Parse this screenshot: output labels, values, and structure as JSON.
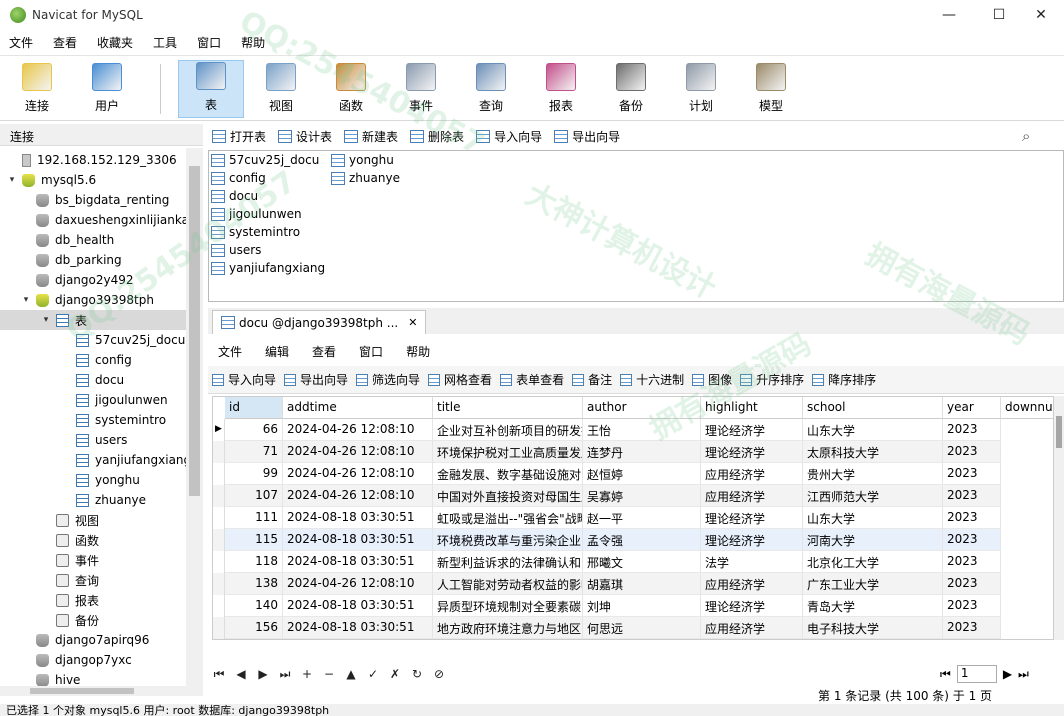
{
  "window": {
    "title": "Navicat for MySQL",
    "minimize": "—",
    "maximize": "☐",
    "close": "✕"
  },
  "menu": [
    "文件",
    "查看",
    "收藏夹",
    "工具",
    "窗口",
    "帮助"
  ],
  "toolbar": [
    {
      "label": "连接",
      "icon": "plug-icon"
    },
    {
      "label": "用户",
      "icon": "user-icon"
    },
    {
      "label": "表",
      "icon": "table-icon",
      "active": true
    },
    {
      "label": "视图",
      "icon": "view-icon"
    },
    {
      "label": "函数",
      "icon": "function-icon"
    },
    {
      "label": "事件",
      "icon": "event-icon"
    },
    {
      "label": "查询",
      "icon": "query-icon"
    },
    {
      "label": "报表",
      "icon": "report-icon"
    },
    {
      "label": "备份",
      "icon": "backup-icon"
    },
    {
      "label": "计划",
      "icon": "schedule-icon"
    },
    {
      "label": "模型",
      "icon": "model-icon"
    }
  ],
  "left_header": "连接",
  "tree": [
    {
      "label": "192.168.152.129_3306",
      "level": 0,
      "icon": "server",
      "twisty": ""
    },
    {
      "label": "mysql5.6",
      "level": 0,
      "icon": "dbopen",
      "twisty": "▾"
    },
    {
      "label": "bs_bigdata_renting",
      "level": 1,
      "icon": "db",
      "twisty": ""
    },
    {
      "label": "daxueshengxinlijiankang",
      "level": 1,
      "icon": "db",
      "twisty": ""
    },
    {
      "label": "db_health",
      "level": 1,
      "icon": "db",
      "twisty": ""
    },
    {
      "label": "db_parking",
      "level": 1,
      "icon": "db",
      "twisty": ""
    },
    {
      "label": "django2y492",
      "level": 1,
      "icon": "db",
      "twisty": ""
    },
    {
      "label": "django39398tph",
      "level": 1,
      "icon": "dbopen",
      "twisty": "▾"
    },
    {
      "label": "表",
      "level": 2,
      "icon": "tbl",
      "twisty": "▾",
      "selected": true
    },
    {
      "label": "57cuv25j_docu",
      "level": 3,
      "icon": "tbl",
      "twisty": ""
    },
    {
      "label": "config",
      "level": 3,
      "icon": "tbl",
      "twisty": ""
    },
    {
      "label": "docu",
      "level": 3,
      "icon": "tbl",
      "twisty": ""
    },
    {
      "label": "jigoulunwen",
      "level": 3,
      "icon": "tbl",
      "twisty": ""
    },
    {
      "label": "systemintro",
      "level": 3,
      "icon": "tbl",
      "twisty": ""
    },
    {
      "label": "users",
      "level": 3,
      "icon": "tbl",
      "twisty": ""
    },
    {
      "label": "yanjiufangxiang",
      "level": 3,
      "icon": "tbl",
      "twisty": ""
    },
    {
      "label": "yonghu",
      "level": 3,
      "icon": "tbl",
      "twisty": ""
    },
    {
      "label": "zhuanye",
      "level": 3,
      "icon": "tbl",
      "twisty": ""
    },
    {
      "label": "视图",
      "level": 2,
      "icon": "misc",
      "twisty": ""
    },
    {
      "label": "函数",
      "level": 2,
      "icon": "misc",
      "twisty": ""
    },
    {
      "label": "事件",
      "level": 2,
      "icon": "misc",
      "twisty": ""
    },
    {
      "label": "查询",
      "level": 2,
      "icon": "misc",
      "twisty": ""
    },
    {
      "label": "报表",
      "level": 2,
      "icon": "misc",
      "twisty": ""
    },
    {
      "label": "备份",
      "level": 2,
      "icon": "misc",
      "twisty": ""
    },
    {
      "label": "django7apirq96",
      "level": 1,
      "icon": "db",
      "twisty": ""
    },
    {
      "label": "djangop7yxc",
      "level": 1,
      "icon": "db",
      "twisty": ""
    },
    {
      "label": "hive",
      "level": 1,
      "icon": "db",
      "twisty": ""
    }
  ],
  "object_toolbar": [
    "打开表",
    "设计表",
    "新建表",
    "删除表",
    "导入向导",
    "导出向导"
  ],
  "objects": [
    "57cuv25j_docu",
    "config",
    "docu",
    "jigoulunwen",
    "systemintro",
    "users",
    "yanjiufangxiang",
    "yonghu",
    "zhuanye"
  ],
  "doc_tab": {
    "label": "docu @django39398tph ...",
    "close": "✕"
  },
  "inner_menu": [
    "文件",
    "编辑",
    "查看",
    "窗口",
    "帮助"
  ],
  "inner_toolbar": [
    "导入向导",
    "导出向导",
    "筛选向导",
    "网格查看",
    "表单查看",
    "备注",
    "十六进制",
    "图像",
    "升序排序",
    "降序排序"
  ],
  "grid": {
    "columns": [
      "id",
      "addtime",
      "title",
      "author",
      "highlight",
      "school",
      "year",
      "downnum"
    ],
    "rows": [
      [
        "66",
        "2024-04-26 12:08:10",
        "企业对互补创新项目的研发投入",
        "王怡",
        "理论经济学",
        "山东大学",
        "2023"
      ],
      [
        "71",
        "2024-04-26 12:08:10",
        "环境保护税对工业高质量发展",
        "连梦丹",
        "理论经济学",
        "太原科技大学",
        "2023"
      ],
      [
        "99",
        "2024-04-26 12:08:10",
        "金融发展、数字基础设施对",
        "赵恒婷",
        "应用经济学",
        "贵州大学",
        "2023"
      ],
      [
        "107",
        "2024-04-26 12:08:10",
        "中国对外直接投资对母国生产",
        "吴寡婷",
        "应用经济学",
        "江西师范大学",
        "2023"
      ],
      [
        "111",
        "2024-08-18 03:30:51",
        "虹吸或是溢出--\"强省会\"战略",
        "赵一平",
        "理论经济学",
        "山东大学",
        "2023"
      ],
      [
        "115",
        "2024-08-18 03:30:51",
        "环境税费改革与重污染企业",
        "孟令强",
        "理论经济学",
        "河南大学",
        "2023"
      ],
      [
        "118",
        "2024-08-18 03:30:51",
        "新型利益诉求的法律确认和",
        "邢曦文",
        "法学",
        "北京化工大学",
        "2023"
      ],
      [
        "138",
        "2024-04-26 12:08:10",
        "人工智能对劳动者权益的影响",
        "胡嘉琪",
        "应用经济学",
        "广东工业大学",
        "2023"
      ],
      [
        "140",
        "2024-08-18 03:30:51",
        "异质型环境规制对全要素碳",
        "刘坤",
        "理论经济学",
        "青岛大学",
        "2023"
      ],
      [
        "156",
        "2024-08-18 03:30:51",
        "地方政府环境注意力与地区",
        "何思远",
        "应用经济学",
        "电子科技大学",
        "2023"
      ]
    ]
  },
  "navigator": {
    "buttons": [
      "⏮",
      "◀",
      "▶",
      "⏭",
      "+",
      "−",
      "▲",
      "✓",
      "✗",
      "↻",
      "⊘"
    ],
    "page": "1"
  },
  "record_status": "第 1 条记录 (共 100 条) 于 1 页",
  "bottom_status": "已选择 1 个对象      mysql5.6   用户: root   数据库: django39398tph",
  "watermarks": [
    "QQ:2545404057",
    "大神计算机设计",
    "拥有海量源码"
  ],
  "colors": {
    "selected_tool": "#cce4f7",
    "watermark": "#78c88c"
  }
}
